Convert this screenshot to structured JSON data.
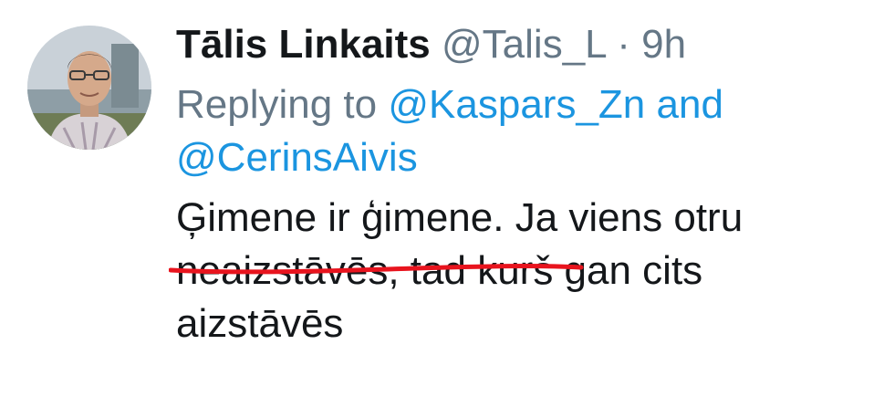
{
  "tweet": {
    "author_name": "Tālis Linkaits",
    "author_handle": "@Talis_L",
    "separator": "·",
    "time": "9h",
    "replying_prefix": "Replying to",
    "reply_mention_1": "@Kaspars_Zn",
    "reply_conjunction": "and",
    "reply_mention_2": "@CerinsAivis",
    "text_highlighted": "Ģimene ir ģimene.",
    "text_rest_line1": " Ja viens otru",
    "text_line2": "neaizstāvēs, tad kurš gan cits",
    "text_line3": "aizstāvēs"
  },
  "colors": {
    "text": "#14171a",
    "secondary": "#657786",
    "link": "#1b95e0",
    "annotation": "#e8141e"
  },
  "icons": {
    "avatar": "profile-photo"
  }
}
